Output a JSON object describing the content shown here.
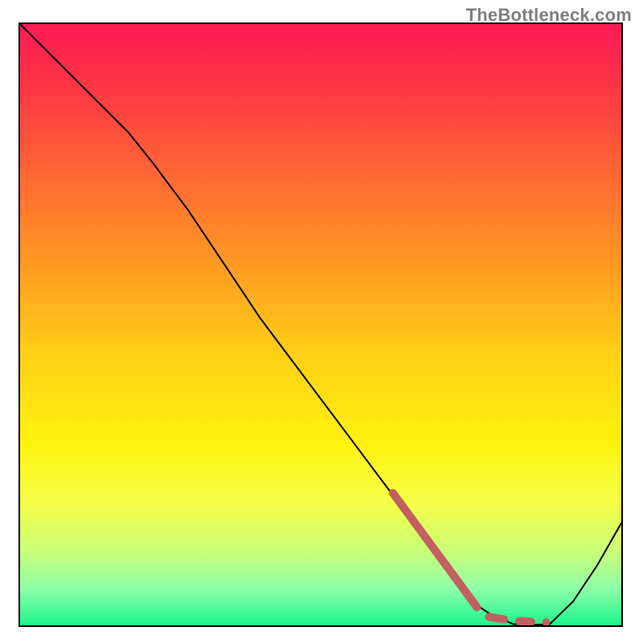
{
  "watermark": "TheBottleneck.com",
  "chart_data": {
    "type": "line",
    "title": "",
    "xlabel": "",
    "ylabel": "",
    "xlim": [
      0,
      100
    ],
    "ylim": [
      0,
      100
    ],
    "grid": false,
    "legend": false,
    "background_gradient_stops": [
      {
        "pos": 0.0,
        "color": "#ff1a55"
      },
      {
        "pos": 0.12,
        "color": "#ff3b43"
      },
      {
        "pos": 0.26,
        "color": "#ff6a32"
      },
      {
        "pos": 0.4,
        "color": "#ff9a22"
      },
      {
        "pos": 0.55,
        "color": "#ffd016"
      },
      {
        "pos": 0.7,
        "color": "#fff30f"
      },
      {
        "pos": 0.8,
        "color": "#f4ff4a"
      },
      {
        "pos": 0.88,
        "color": "#c7ff7a"
      },
      {
        "pos": 0.94,
        "color": "#8dffaa"
      },
      {
        "pos": 1.0,
        "color": "#1cf58b"
      }
    ],
    "series": [
      {
        "name": "bottleneck-curve",
        "stroke": "#000000",
        "stroke_width": 2,
        "x": [
          0,
          6,
          12,
          18,
          22,
          28,
          34,
          40,
          46,
          52,
          58,
          64,
          68,
          72,
          75,
          78,
          82,
          85,
          88,
          92,
          96,
          100
        ],
        "y": [
          100,
          94,
          88,
          82,
          77,
          69,
          60,
          51,
          43,
          35,
          27,
          19,
          13,
          8,
          4,
          2,
          0.2,
          0.1,
          0.1,
          4,
          10,
          17
        ]
      }
    ],
    "highlight": {
      "name": "recommended-range-marker",
      "stroke": "#c36060",
      "stroke_width": 10,
      "linecap": "round",
      "segments": [
        {
          "x": [
            62,
            76
          ],
          "y": [
            22,
            3
          ]
        },
        {
          "x": [
            78,
            80.5
          ],
          "y": [
            1.4,
            1.0
          ]
        },
        {
          "x": [
            83,
            85
          ],
          "y": [
            0.7,
            0.6
          ]
        },
        {
          "x": [
            87.5,
            87.5
          ],
          "y": [
            0.5,
            0.5
          ]
        }
      ]
    }
  }
}
